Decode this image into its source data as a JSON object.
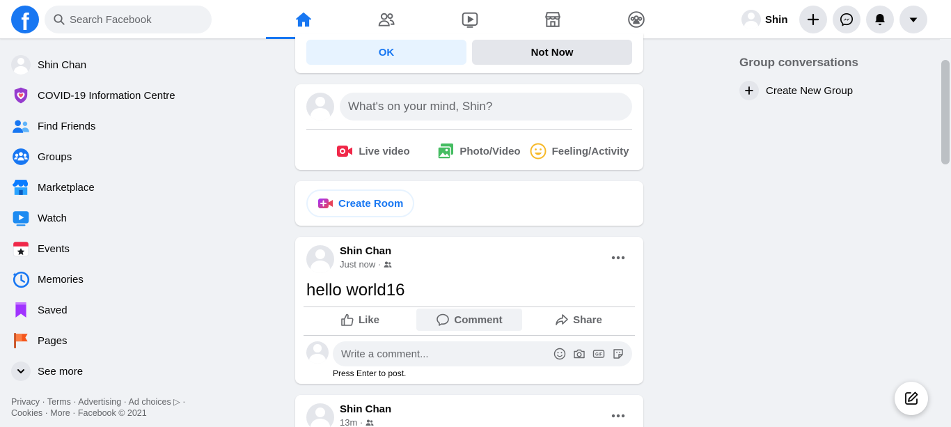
{
  "topbar": {
    "search_placeholder": "Search Facebook",
    "logo_letter": "f",
    "nav_tabs": [
      "Home",
      "Friends",
      "Watch",
      "Marketplace",
      "Groups"
    ],
    "profile_name": "Shin",
    "accent_color": "#1877f2"
  },
  "sidebar": {
    "items": [
      {
        "label": "Shin Chan",
        "icon": "avatar"
      },
      {
        "label": "COVID-19 Information Centre",
        "icon": "shield-heart-icon"
      },
      {
        "label": "Find Friends",
        "icon": "friends-icon"
      },
      {
        "label": "Groups",
        "icon": "groups-icon"
      },
      {
        "label": "Marketplace",
        "icon": "shop-icon"
      },
      {
        "label": "Watch",
        "icon": "watch-play-icon"
      },
      {
        "label": "Events",
        "icon": "calendar-star-icon"
      },
      {
        "label": "Memories",
        "icon": "clock-icon"
      },
      {
        "label": "Saved",
        "icon": "bookmark-icon"
      },
      {
        "label": "Pages",
        "icon": "flag-icon"
      },
      {
        "label": "See more",
        "icon": "chevron-down-icon"
      }
    ],
    "footer_line1": "Privacy · Terms · Advertising · Ad choices ▷ ·",
    "footer_line2": "Cookies · More · Facebook © 2021"
  },
  "prompt_card": {
    "ok_label": "OK",
    "not_now_label": "Not Now"
  },
  "composer": {
    "placeholder": "What's on your mind, Shin?",
    "live_label": "Live video",
    "photo_label": "Photo/Video",
    "feeling_label": "Feeling/Activity"
  },
  "room": {
    "label": "Create Room"
  },
  "posts": [
    {
      "author": "Shin Chan",
      "time": "Just now ·",
      "text": "hello world16",
      "like_label": "Like",
      "comment_label": "Comment",
      "share_label": "Share",
      "comment_placeholder": "Write a comment...",
      "hint": "Press Enter to post."
    },
    {
      "author": "Shin Chan",
      "time": "13m ·"
    }
  ],
  "right": {
    "title": "Group conversations",
    "create_label": "Create New Group"
  }
}
